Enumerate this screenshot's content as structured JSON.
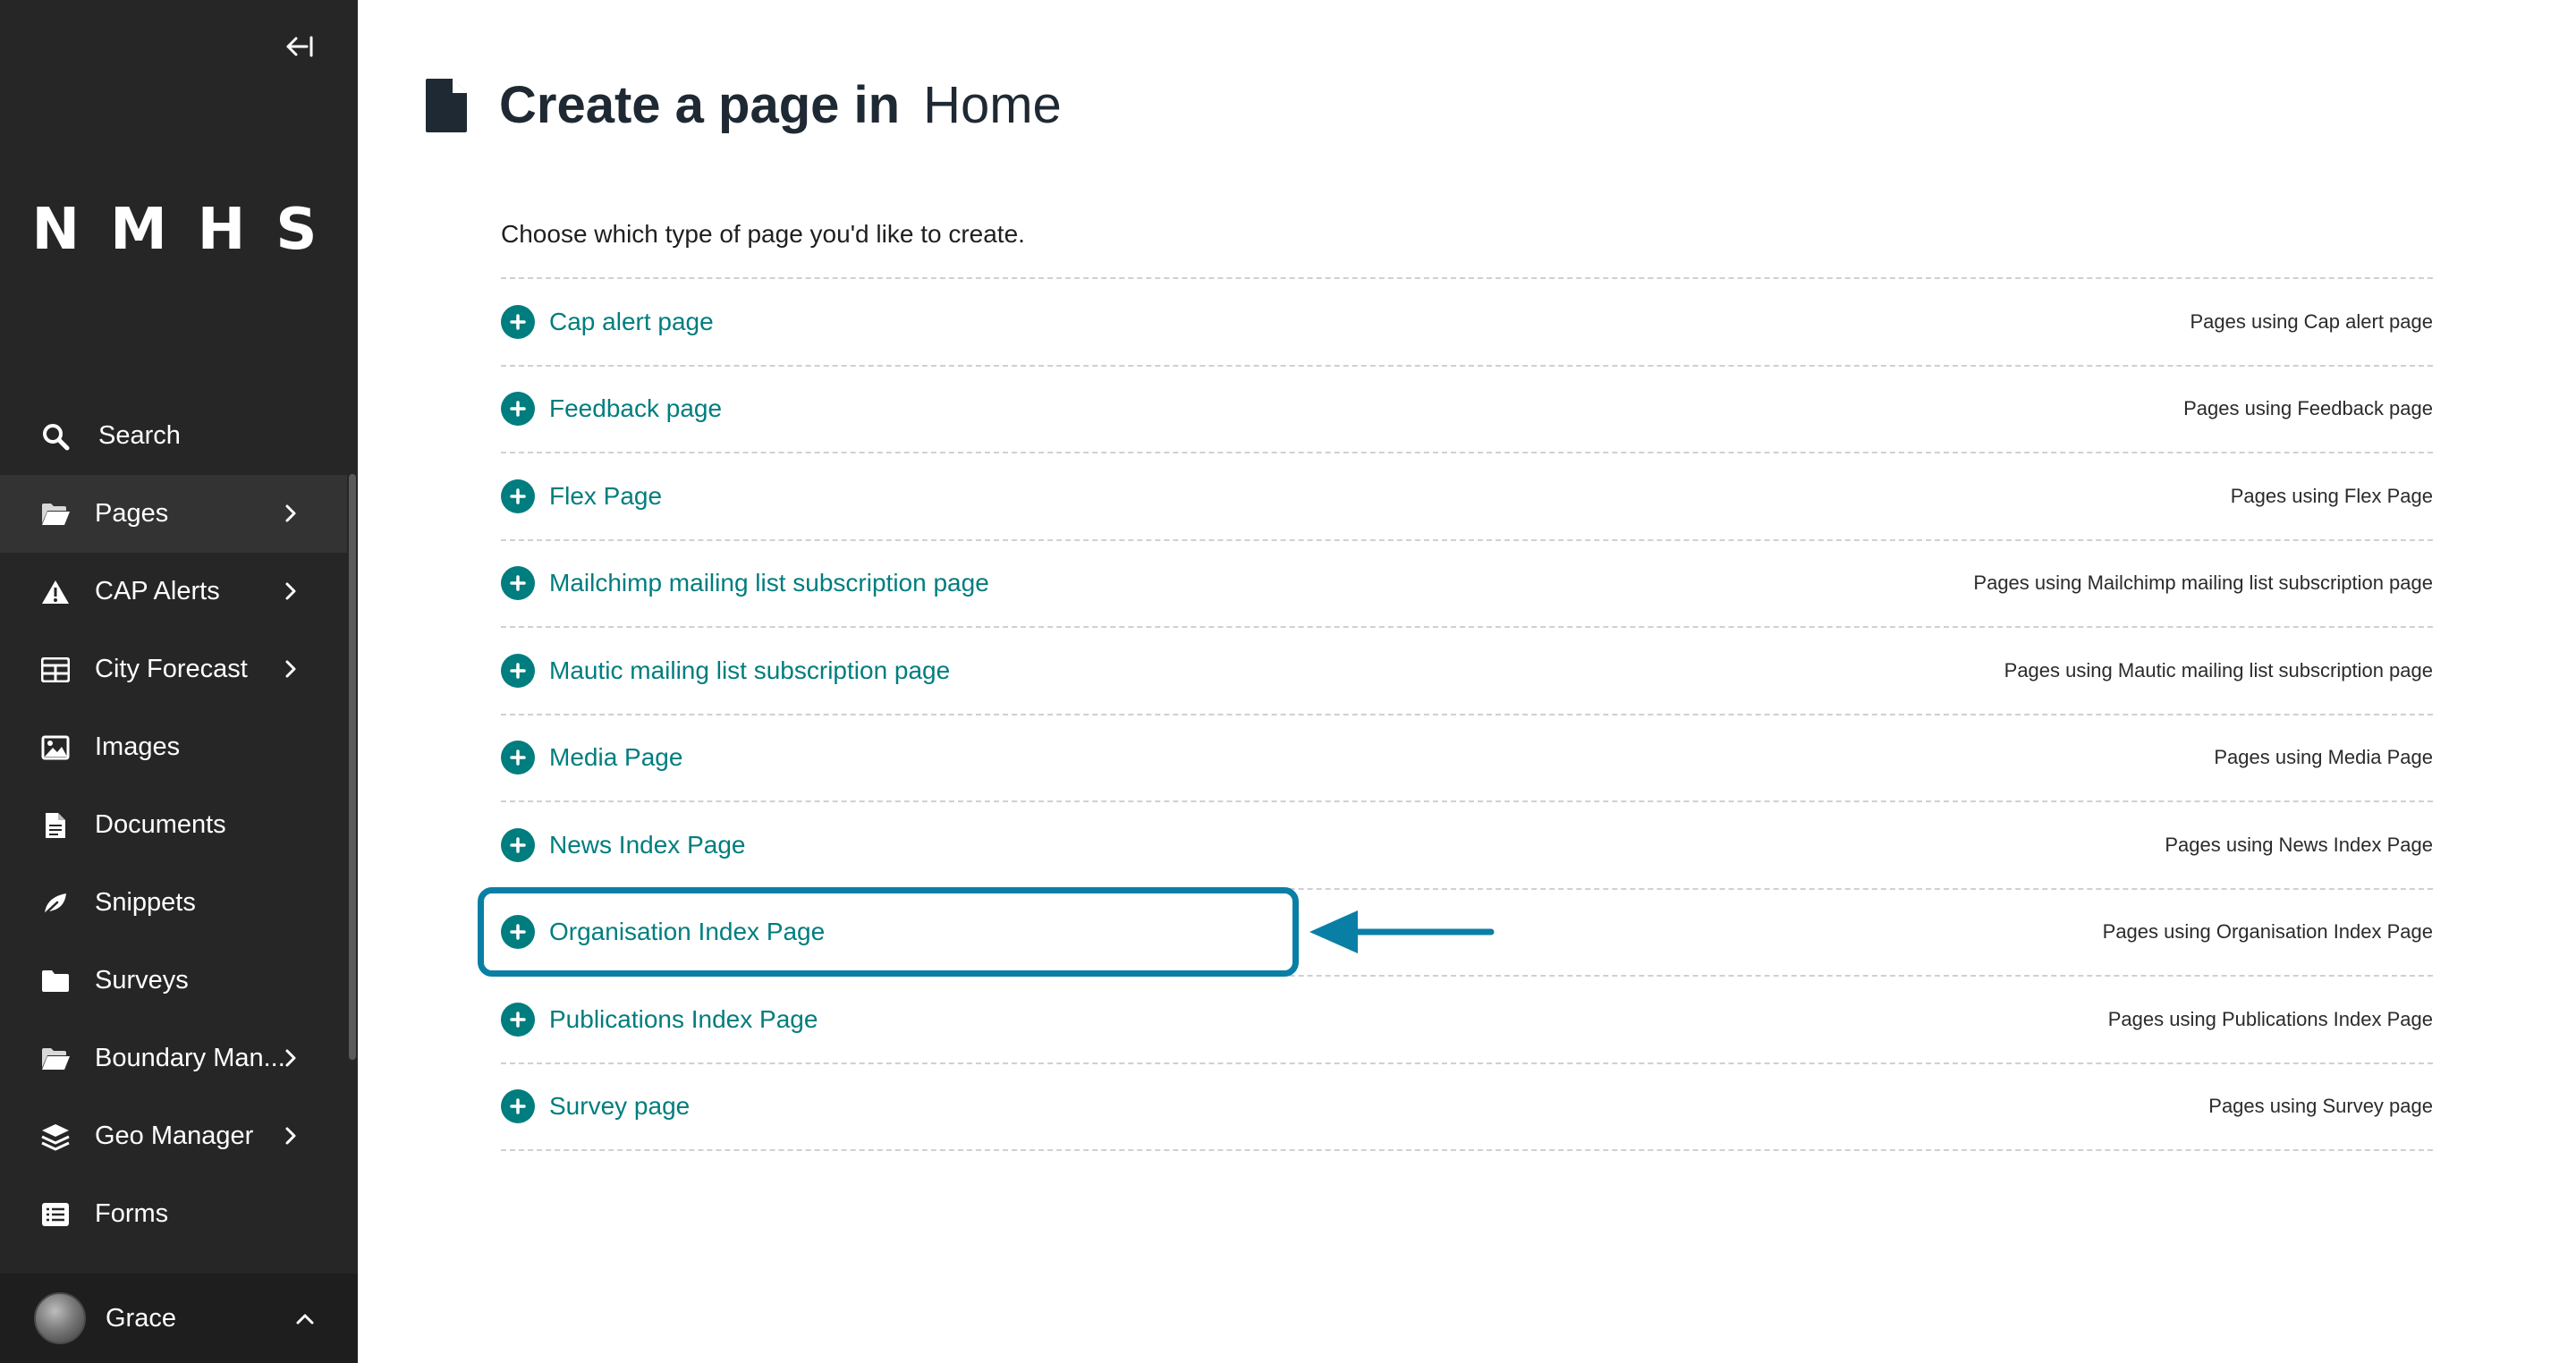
{
  "sidebar": {
    "logo_text": "NMHS",
    "collapse_icon": "collapse-left-icon",
    "items": [
      {
        "label": "Search",
        "icon": "search-icon",
        "has_children": false
      },
      {
        "label": "Pages",
        "icon": "folder-open-icon",
        "has_children": true,
        "active": true
      },
      {
        "label": "CAP Alerts",
        "icon": "warning-icon",
        "has_children": true
      },
      {
        "label": "City Forecast",
        "icon": "table-icon",
        "has_children": true
      },
      {
        "label": "Images",
        "icon": "image-icon",
        "has_children": false
      },
      {
        "label": "Documents",
        "icon": "document-icon",
        "has_children": false
      },
      {
        "label": "Snippets",
        "icon": "snippet-icon",
        "has_children": false
      },
      {
        "label": "Surveys",
        "icon": "folder-icon",
        "has_children": false
      },
      {
        "label": "Boundary Man...",
        "icon": "folder-open-icon",
        "has_children": true
      },
      {
        "label": "Geo Manager",
        "icon": "layers-icon",
        "has_children": true
      },
      {
        "label": "Forms",
        "icon": "list-icon",
        "has_children": false
      }
    ],
    "user": {
      "name": "Grace",
      "icon": "chevron-up-icon"
    }
  },
  "header": {
    "title_prefix": "Create a page in",
    "parent_page": "Home",
    "icon": "document-icon"
  },
  "content": {
    "intro": "Choose which type of page you'd like to create.",
    "page_types": [
      {
        "name": "Cap alert page",
        "usage": "Pages using Cap alert page"
      },
      {
        "name": "Feedback page",
        "usage": "Pages using Feedback page"
      },
      {
        "name": "Flex Page",
        "usage": "Pages using Flex Page"
      },
      {
        "name": "Mailchimp mailing list subscription page",
        "usage": "Pages using Mailchimp mailing list subscription page"
      },
      {
        "name": "Mautic mailing list subscription page",
        "usage": "Pages using Mautic mailing list subscription page"
      },
      {
        "name": "Media Page",
        "usage": "Pages using Media Page"
      },
      {
        "name": "News Index Page",
        "usage": "Pages using News Index Page"
      },
      {
        "name": "Organisation Index Page",
        "usage": "Pages using Organisation Index Page",
        "highlighted": true
      },
      {
        "name": "Publications Index Page",
        "usage": "Pages using Publications Index Page"
      },
      {
        "name": "Survey page",
        "usage": "Pages using Survey page"
      }
    ]
  },
  "colors": {
    "sidebar_bg": "#262626",
    "accent_teal": "#007d7e",
    "annotation_blue": "#0a7fa6"
  }
}
